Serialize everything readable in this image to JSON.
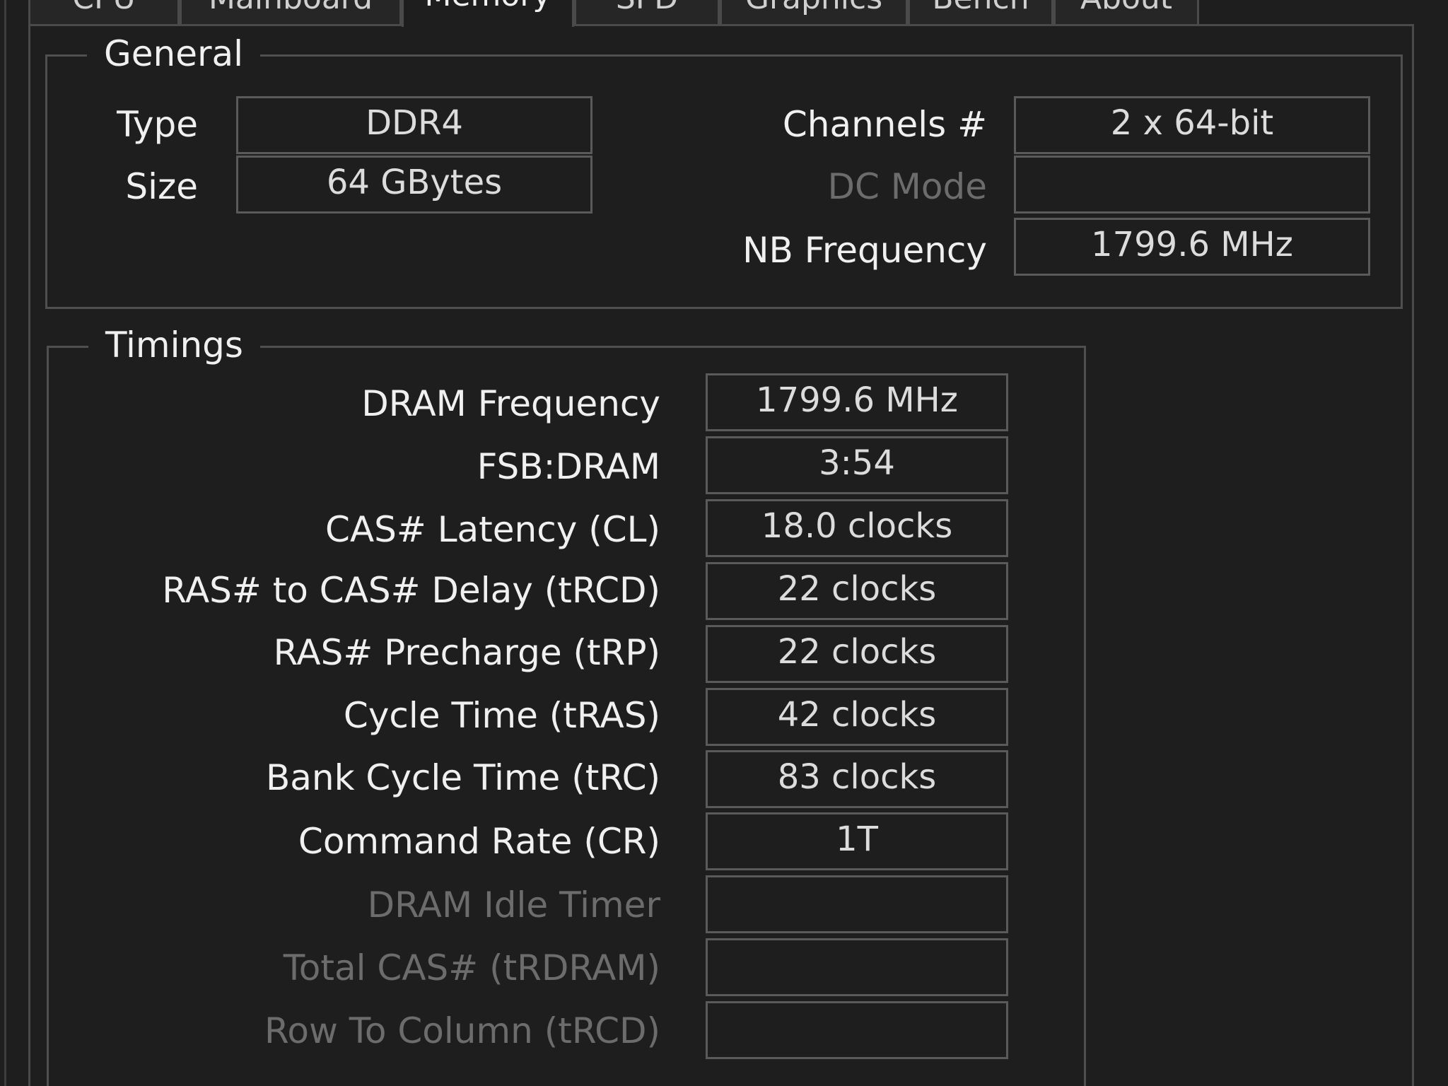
{
  "tabs": [
    {
      "label": "CPU"
    },
    {
      "label": "Mainboard"
    },
    {
      "label": "Memory"
    },
    {
      "label": "SPD"
    },
    {
      "label": "Graphics"
    },
    {
      "label": "Bench"
    },
    {
      "label": "About"
    }
  ],
  "active_tab": "Memory",
  "general": {
    "legend": "General",
    "type_label": "Type",
    "type_value": "DDR4",
    "size_label": "Size",
    "size_value": "64 GBytes",
    "channels_label": "Channels #",
    "channels_value": "2 x 64-bit",
    "dc_mode_label": "DC Mode",
    "dc_mode_value": "",
    "nb_freq_label": "NB Frequency",
    "nb_freq_value": "1799.6 MHz"
  },
  "timings": {
    "legend": "Timings",
    "rows": [
      {
        "label": "DRAM Frequency",
        "value": "1799.6 MHz",
        "enabled": true
      },
      {
        "label": "FSB:DRAM",
        "value": "3:54",
        "enabled": true
      },
      {
        "label": "CAS# Latency (CL)",
        "value": "18.0 clocks",
        "enabled": true
      },
      {
        "label": "RAS# to CAS# Delay (tRCD)",
        "value": "22 clocks",
        "enabled": true
      },
      {
        "label": "RAS# Precharge (tRP)",
        "value": "22 clocks",
        "enabled": true
      },
      {
        "label": "Cycle Time (tRAS)",
        "value": "42 clocks",
        "enabled": true
      },
      {
        "label": "Bank Cycle Time (tRC)",
        "value": "83 clocks",
        "enabled": true
      },
      {
        "label": "Command Rate (CR)",
        "value": "1T",
        "enabled": true
      },
      {
        "label": "DRAM Idle Timer",
        "value": "",
        "enabled": false
      },
      {
        "label": "Total CAS# (tRDRAM)",
        "value": "",
        "enabled": false
      },
      {
        "label": "Row To Column (tRCD)",
        "value": "",
        "enabled": false
      }
    ]
  }
}
